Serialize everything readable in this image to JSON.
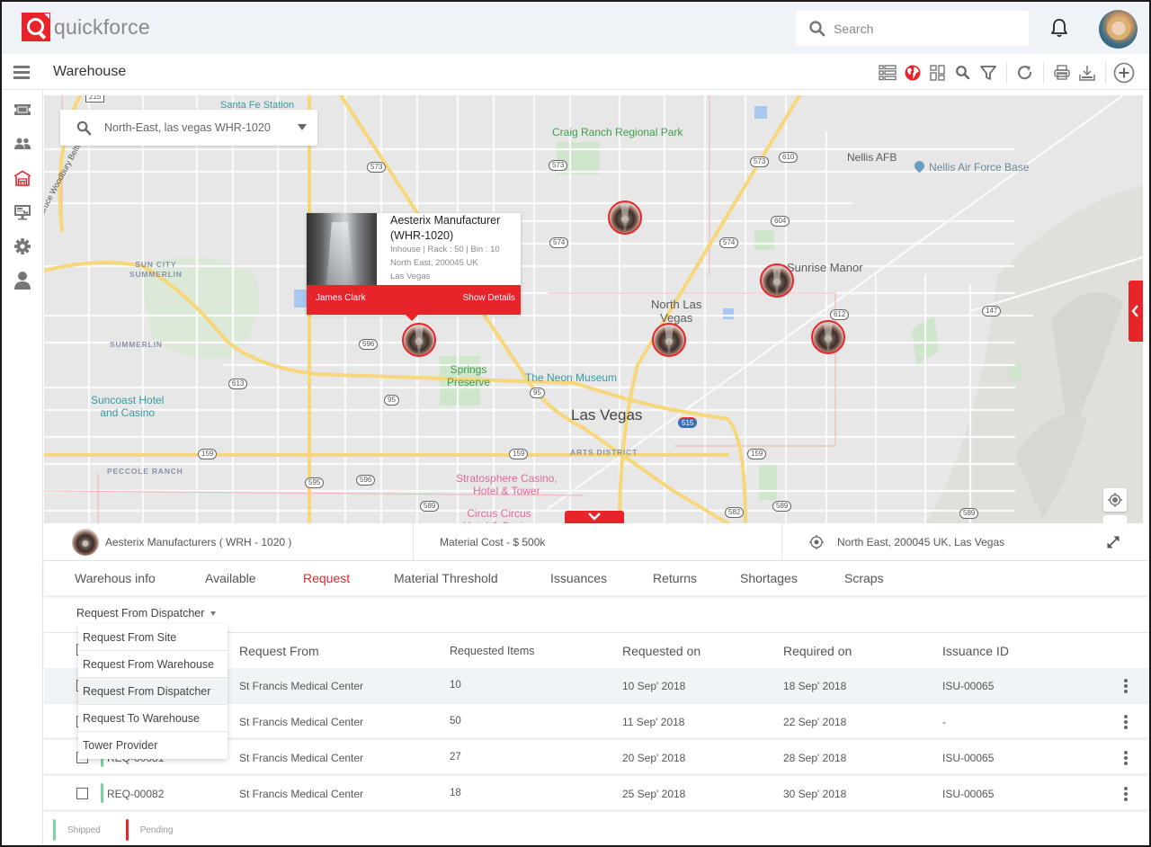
{
  "app": {
    "name": "quickforce",
    "search_placeholder": "Search"
  },
  "header": {
    "title": "Warehouse",
    "toolbar": [
      "list-view-icon",
      "globe-icon",
      "grid-view-icon",
      "search-icon",
      "filter-icon",
      "refresh-icon",
      "print-icon",
      "download-icon",
      "add-icon"
    ]
  },
  "sidebar": {
    "items": [
      {
        "name": "dashboard",
        "icon": "ticket-icon",
        "active": false
      },
      {
        "name": "users",
        "icon": "users-icon",
        "active": false
      },
      {
        "name": "warehouse",
        "icon": "warehouse-icon",
        "active": true
      },
      {
        "name": "monitor",
        "icon": "monitor-icon",
        "active": false
      },
      {
        "name": "settings",
        "icon": "gear-icon",
        "active": false
      },
      {
        "name": "profile",
        "icon": "user-icon",
        "active": false
      }
    ]
  },
  "map": {
    "search_value": "North-East, las vegas WHR-1020",
    "labels": {
      "craig_ranch": "Craig Ranch\nRegional Park",
      "nellis_afb": "Nellis AFB",
      "nellis_base": "Nellis Air Force Base",
      "sunrise_manor": "Sunrise Manor",
      "north_las_vegas": "North Las\nVegas",
      "sun_city": "SUN CITY\nSUMMERLIN",
      "summerlin": "SUMMERLIN",
      "suncoast": "Suncoast Hotel\nand Casino",
      "springs_preserve": "Springs\nPreserve",
      "neon_museum": "The Neon Museum",
      "las_vegas": "Las Vegas",
      "arts_district": "ARTS DISTRICT",
      "peccole_ranch": "PECCOLE RANCH",
      "stratosphere": "Stratosphere Casino,\nHotel & Tower",
      "circus_circus": "Circus Circus\nHotel & Casino",
      "santa_fe": "Santa Fe Station",
      "beltway": "Bruce Woodbury Beltway"
    },
    "shields": [
      "573",
      "573",
      "573",
      "610",
      "604",
      "574",
      "574",
      "612",
      "147",
      "596",
      "613",
      "95",
      "95",
      "159",
      "159",
      "159",
      "595",
      "596",
      "589",
      "589",
      "589",
      "582",
      "515",
      "215"
    ],
    "popup": {
      "title": "Aesterix Manufacturer (WHR-1020)",
      "line1": "Inhouse | Rack : 50 | Bin : 10",
      "line2": "North East, 200045 UK",
      "line3": "Las Vegas",
      "person": "James Clark",
      "action": "Show Details"
    }
  },
  "info_strip": {
    "warehouse": "Aesterix Manufacturers ( WRH - 1020 )",
    "material_cost": "Material Cost - $ 500k",
    "location": "North East, 200045 UK, Las Vegas"
  },
  "tabs": [
    {
      "label": "Warehous info",
      "active": false
    },
    {
      "label": "Available",
      "active": false
    },
    {
      "label": "Request",
      "active": true
    },
    {
      "label": "Material Threshold",
      "active": false
    },
    {
      "label": "Issuances",
      "active": false
    },
    {
      "label": "Returns",
      "active": false
    },
    {
      "label": "Shortages",
      "active": false
    },
    {
      "label": "Scraps",
      "active": false
    }
  ],
  "filter": {
    "selected": "Request From Dispatcher",
    "options": [
      "Request From Site",
      "Request From Warehouse",
      "Request From Dispatcher",
      "Request To Warehouse",
      "Tower Provider"
    ]
  },
  "table": {
    "columns": [
      "Request From",
      "Requested Items",
      "Requested on",
      "Required on",
      "Issuance ID"
    ],
    "rows": [
      {
        "id": "",
        "from": "St Francis Medical Center",
        "items": "10",
        "requested_on": "10 Sep' 2018",
        "required_on": "18 Sep' 2018",
        "issuance_id": "ISU-00065",
        "status": "shipped"
      },
      {
        "id": "",
        "from": "St Francis Medical Center",
        "items": "50",
        "requested_on": "11 Sep' 2018",
        "required_on": "22 Sep' 2018",
        "issuance_id": "-",
        "status": "shipped"
      },
      {
        "id": "REQ-00081",
        "from": "St Francis Medical Center",
        "items": "27",
        "requested_on": "20 Sep' 2018",
        "required_on": "28 Sep' 2018",
        "issuance_id": "ISU-00065",
        "status": "shipped"
      },
      {
        "id": "REQ-00082",
        "from": "St Francis Medical Center",
        "items": "18",
        "requested_on": "25 Sep' 2018",
        "required_on": "30 Sep' 2018",
        "issuance_id": "ISU-00065",
        "status": "shipped"
      }
    ]
  },
  "legend": [
    {
      "label": "Shipped",
      "color": "#7dd3a0"
    },
    {
      "label": "Pending",
      "color": "#e8242b"
    }
  ],
  "colors": {
    "accent": "#e8242b",
    "shipped": "#7dd3a0",
    "pending": "#e8242b"
  }
}
